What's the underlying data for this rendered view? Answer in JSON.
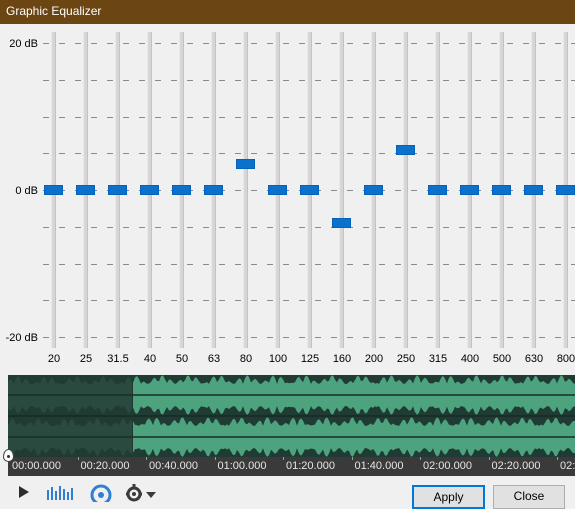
{
  "window": {
    "title": "Graphic Equalizer"
  },
  "equalizer": {
    "db_labels": {
      "top": "20 dB",
      "middle": "0 dB",
      "bottom": "-20 dB"
    },
    "db_range": [
      -20,
      20
    ],
    "bands": [
      {
        "freq": "20",
        "gain_db": 0
      },
      {
        "freq": "25",
        "gain_db": 0
      },
      {
        "freq": "31.5",
        "gain_db": 0
      },
      {
        "freq": "40",
        "gain_db": 0
      },
      {
        "freq": "50",
        "gain_db": 0
      },
      {
        "freq": "63",
        "gain_db": 0
      },
      {
        "freq": "80",
        "gain_db": 3.5
      },
      {
        "freq": "100",
        "gain_db": 0
      },
      {
        "freq": "125",
        "gain_db": 0
      },
      {
        "freq": "160",
        "gain_db": -4.5
      },
      {
        "freq": "200",
        "gain_db": 0
      },
      {
        "freq": "250",
        "gain_db": 5.5
      },
      {
        "freq": "315",
        "gain_db": 0
      },
      {
        "freq": "400",
        "gain_db": 0
      },
      {
        "freq": "500",
        "gain_db": 0
      },
      {
        "freq": "630",
        "gain_db": 0
      },
      {
        "freq": "800",
        "gain_db": 0
      }
    ]
  },
  "waveform": {
    "played_color": "#2a4a3f",
    "unplayed_color": "#4ca37d",
    "played_fraction": 0.22
  },
  "timeline": {
    "labels": [
      "00:00.000",
      "00:20.000",
      "00:40.000",
      "01:00.000",
      "01:20.000",
      "01:40.000",
      "02:00.000",
      "02:20.000",
      "02:"
    ]
  },
  "toolbar": {
    "icons": [
      "play-icon",
      "waveform-icon",
      "target-icon",
      "gear-icon",
      "dropdown-arrow-icon"
    ],
    "apply_label": "Apply",
    "close_label": "Close"
  }
}
